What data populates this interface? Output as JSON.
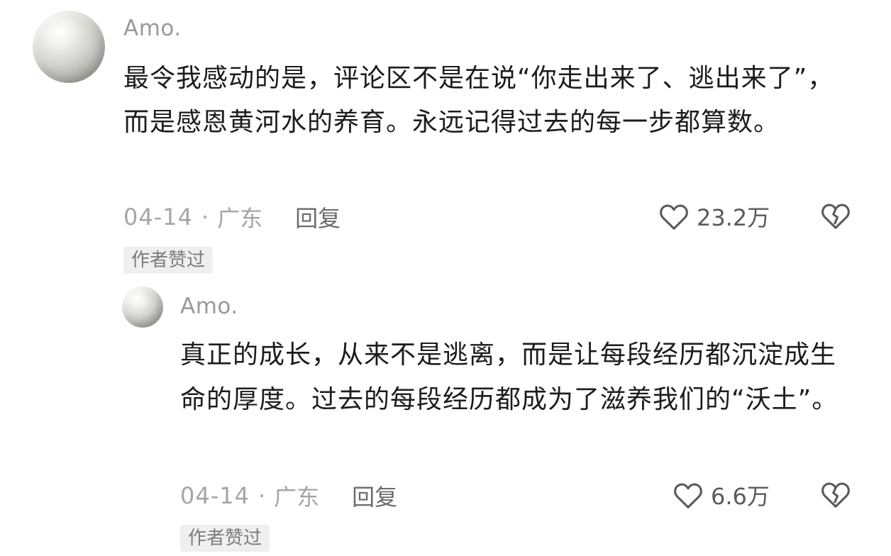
{
  "comments": [
    {
      "username": "Amo.",
      "text": "最令我感动的是，评论区不是在说“你走出来了、逃出来了”，而是感恩黄河水的养育。永远记得过去的每一步都算数。",
      "date": "04-14",
      "separator": "·",
      "location": "广东",
      "reply_label": "回复",
      "like_count": "23.2万",
      "badge": "作者赞过"
    },
    {
      "username": "Amo.",
      "text": "真正的成长，从来不是逃离，而是让每段经历都沉淀成生命的厚度。过去的每段经历都成为了滋养我们的“沃土”。",
      "date": "04-14",
      "separator": "·",
      "location": "广东",
      "reply_label": "回复",
      "like_count": "6.6万",
      "badge": "作者赞过"
    }
  ],
  "icons": {
    "like": "heart-outline-icon",
    "dislike": "broken-heart-icon"
  },
  "colors": {
    "username": "#9a9a9a",
    "meta": "#a5a5a5",
    "badge_bg": "#efefef",
    "icon": "#5a5a5a"
  }
}
